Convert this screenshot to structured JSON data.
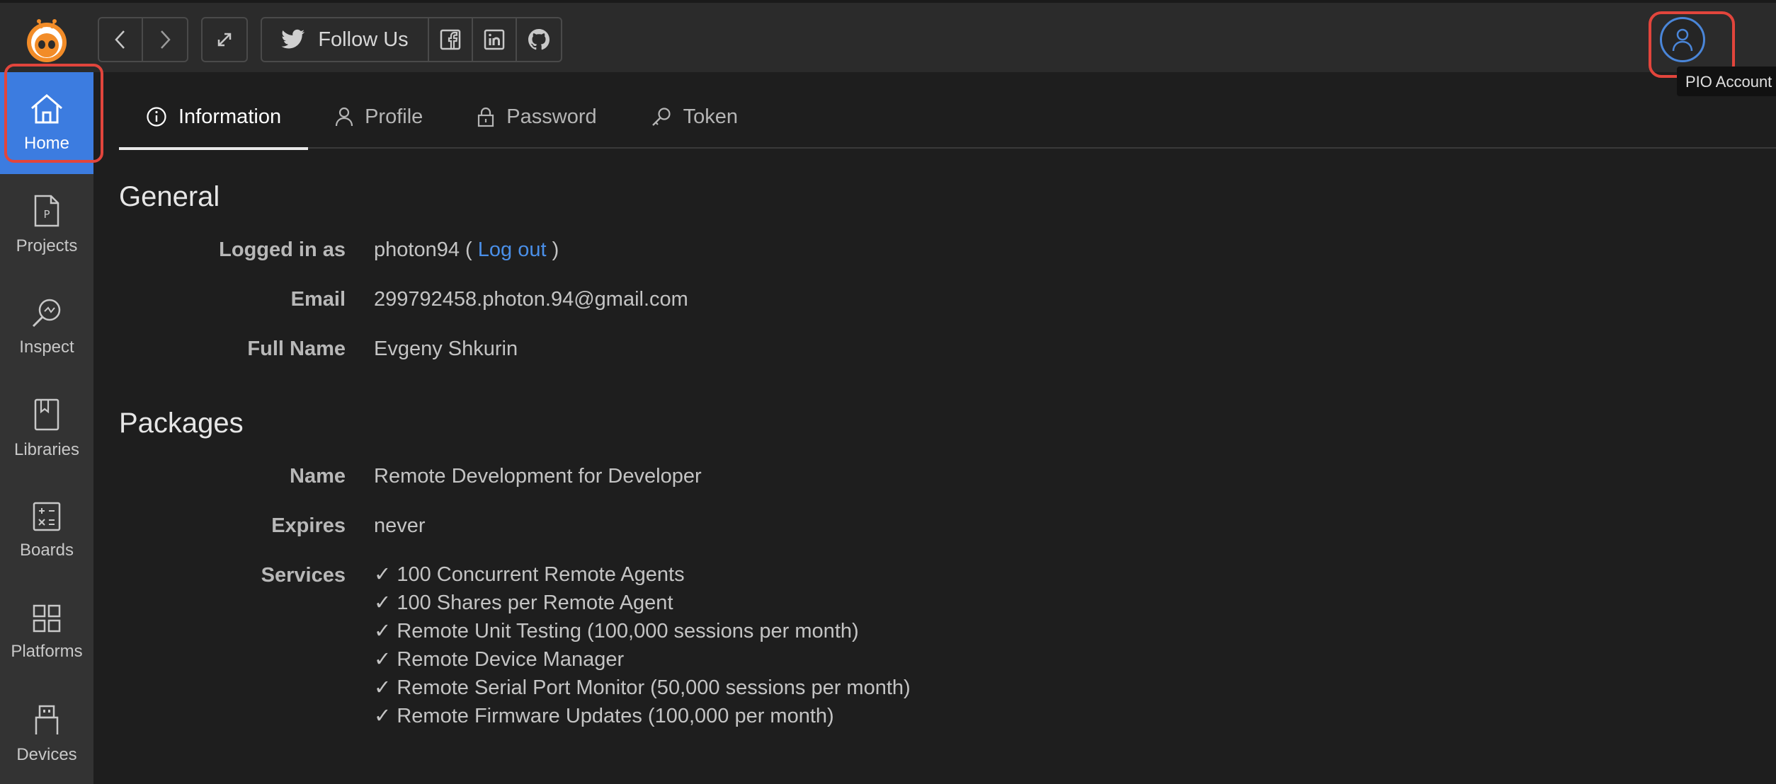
{
  "toolbar": {
    "follow_label": "Follow Us",
    "account_tooltip": "PIO Account"
  },
  "sidebar": {
    "items": [
      {
        "label": "Home",
        "icon": "home-icon",
        "active": true
      },
      {
        "label": "Projects",
        "icon": "project-file-icon"
      },
      {
        "label": "Inspect",
        "icon": "inspect-icon"
      },
      {
        "label": "Libraries",
        "icon": "book-icon"
      },
      {
        "label": "Boards",
        "icon": "calculator-icon"
      },
      {
        "label": "Platforms",
        "icon": "grid-icon"
      },
      {
        "label": "Devices",
        "icon": "usb-icon"
      }
    ]
  },
  "tabs": [
    {
      "label": "Information",
      "icon": "info-icon",
      "active": true
    },
    {
      "label": "Profile",
      "icon": "user-icon"
    },
    {
      "label": "Password",
      "icon": "lock-icon"
    },
    {
      "label": "Token",
      "icon": "key-icon"
    }
  ],
  "general": {
    "title": "General",
    "logged_in_label": "Logged in as",
    "username": "photon94",
    "paren_open": "(",
    "logout_label": "Log out",
    "paren_close": ")",
    "email_label": "Email",
    "email": "299792458.photon.94@gmail.com",
    "fullname_label": "Full Name",
    "fullname": "Evgeny Shkurin"
  },
  "packages": {
    "title": "Packages",
    "name_label": "Name",
    "name": "Remote Development for Developer",
    "expires_label": "Expires",
    "expires": "never",
    "services_label": "Services",
    "services": [
      "✓ 100 Concurrent Remote Agents",
      "✓ 100 Shares per Remote Agent",
      "✓ Remote Unit Testing (100,000 sessions per month)",
      "✓ Remote Device Manager",
      "✓ Remote Serial Port Monitor (50,000 sessions per month)",
      "✓ Remote Firmware Updates (100,000 per month)"
    ]
  },
  "colors": {
    "accent": "#3c7ce0",
    "link": "#4a8fe8",
    "highlight": "#e2453c",
    "logo_orange": "#f28c28"
  }
}
